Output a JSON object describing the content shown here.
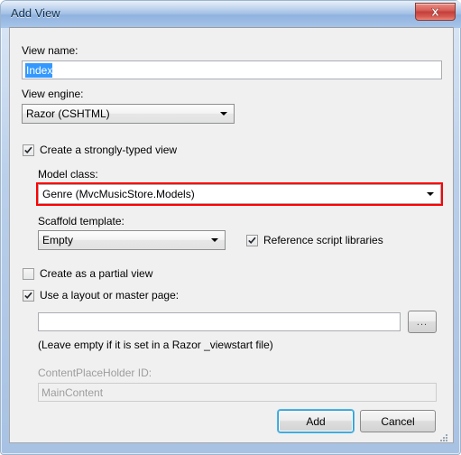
{
  "window": {
    "title": "Add View",
    "close_label": "x",
    "accent_blue": "#3399ff",
    "highlight_red": "#ff0000"
  },
  "form": {
    "view_name": {
      "label": "View name:",
      "value": "Index",
      "selected": true
    },
    "view_engine": {
      "label": "View engine:",
      "value": "Razor (CSHTML)"
    },
    "strongly_typed": {
      "label": "Create a strongly-typed view",
      "checked": true
    },
    "model_class": {
      "label": "Model class:",
      "value": "Genre (MvcMusicStore.Models)",
      "highlighted": true
    },
    "scaffold_template": {
      "label": "Scaffold template:",
      "value": "Empty"
    },
    "reference_scripts": {
      "label": "Reference script libraries",
      "checked": true
    },
    "partial_view": {
      "label": "Create as a partial view",
      "checked": false
    },
    "use_layout": {
      "label": "Use a layout or master page:",
      "checked": true
    },
    "layout_path": {
      "value": "",
      "browse_label": "..."
    },
    "layout_hint": "(Leave empty if it is set in a Razor _viewstart file)",
    "content_placeholder": {
      "label": "ContentPlaceHolder ID:",
      "value": "MainContent",
      "disabled": true
    }
  },
  "buttons": {
    "add": "Add",
    "cancel": "Cancel"
  }
}
